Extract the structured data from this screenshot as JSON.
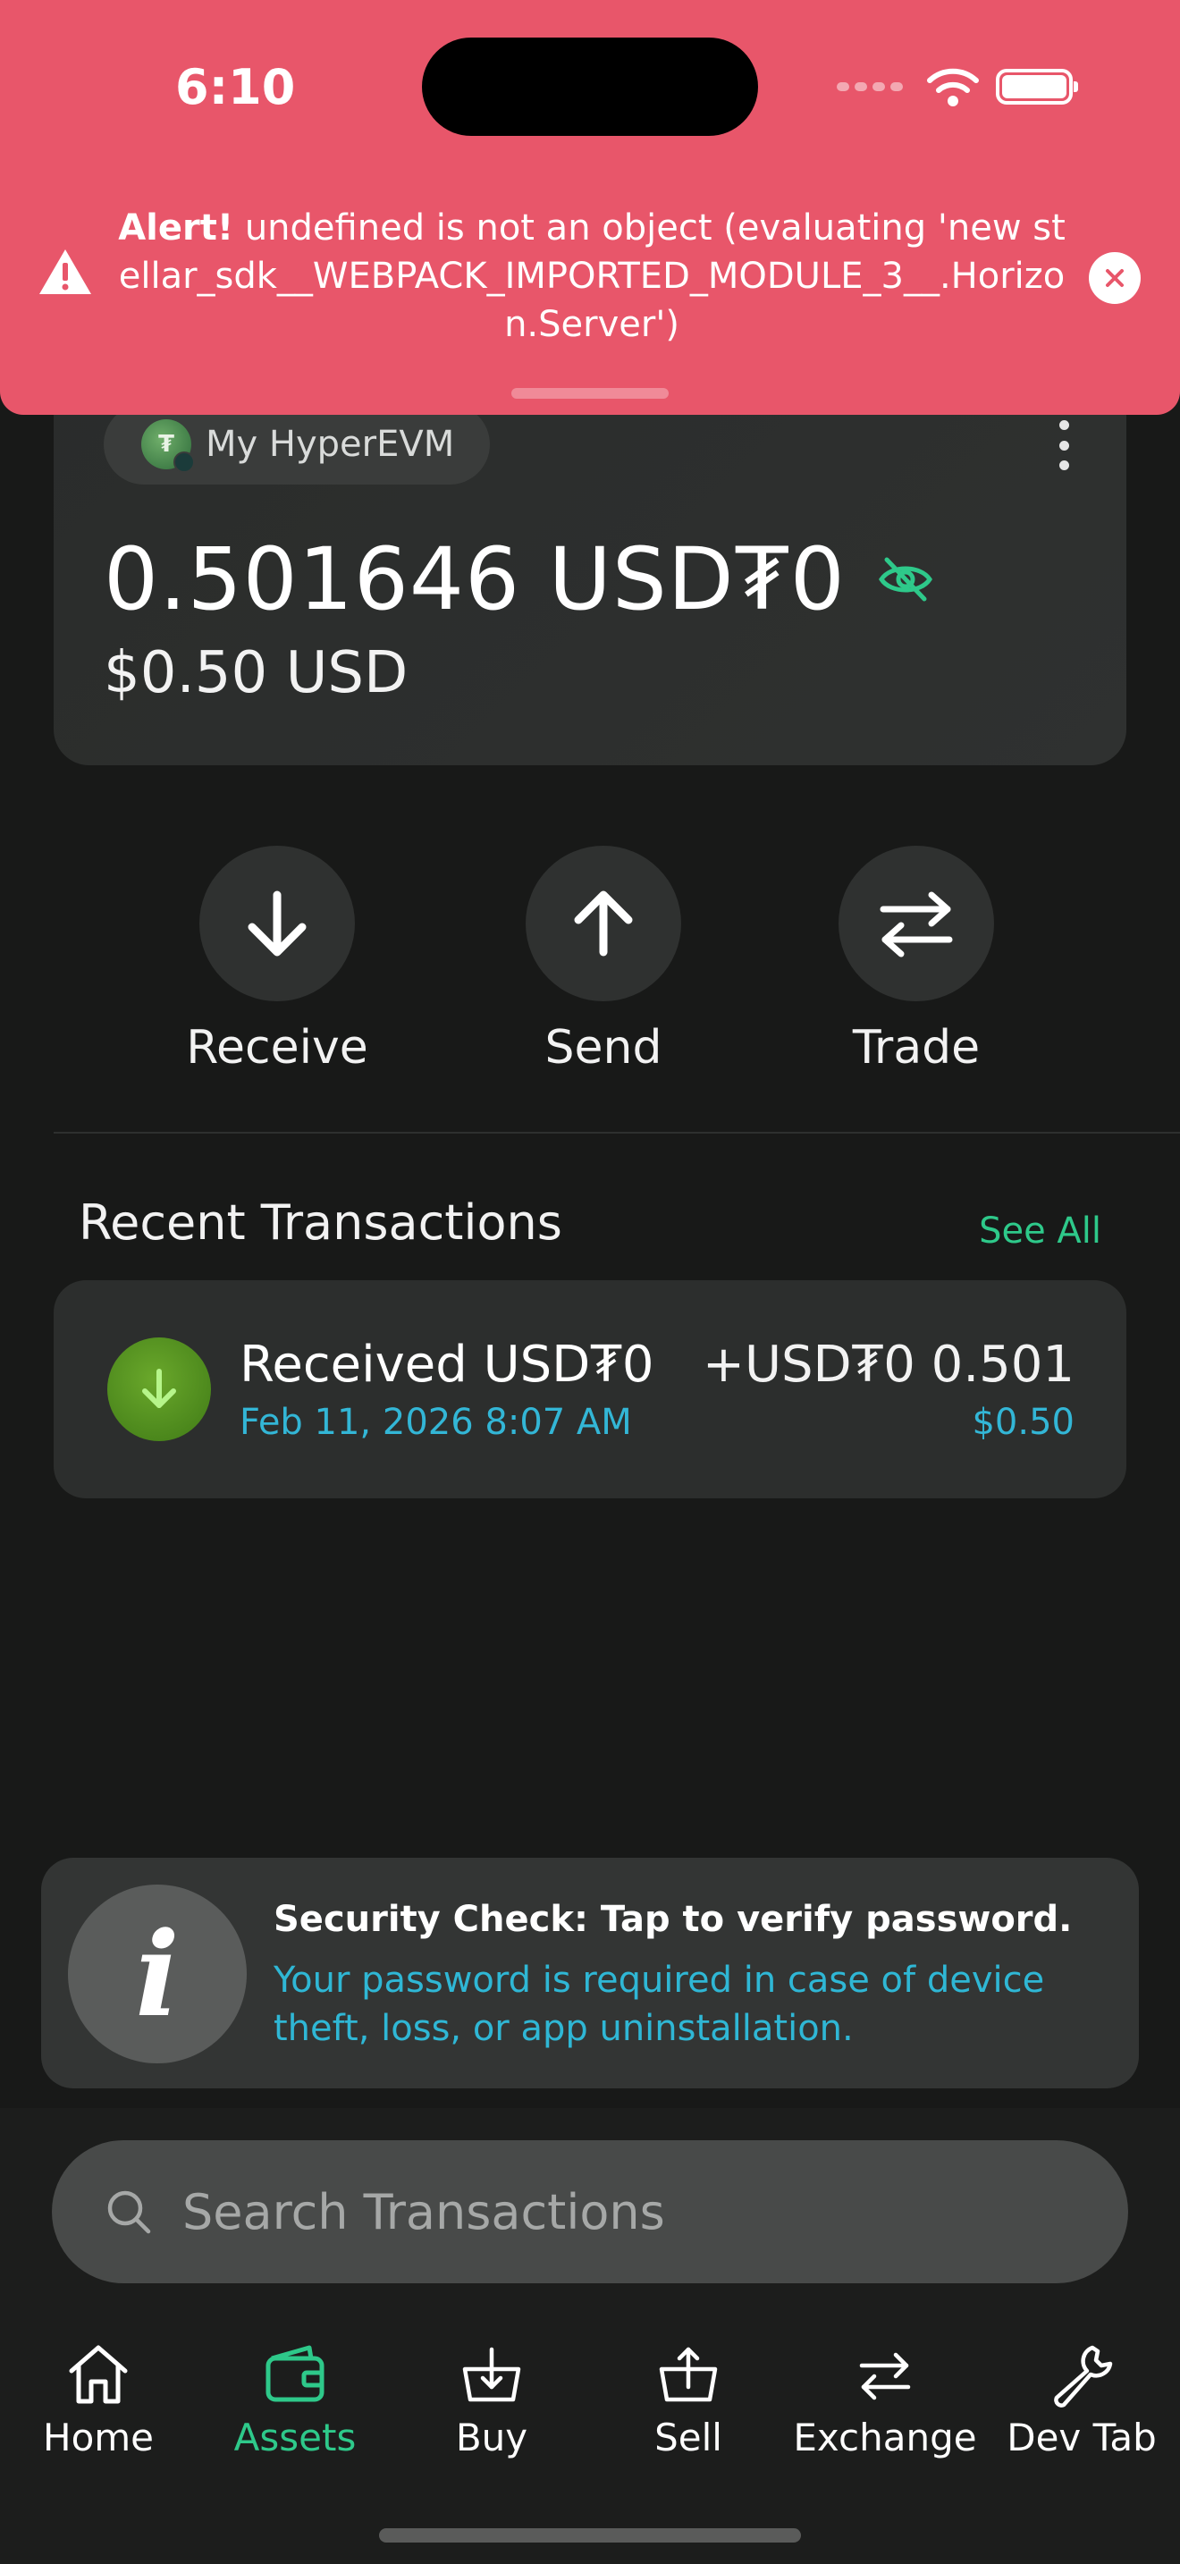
{
  "status_bar": {
    "time": "6:10"
  },
  "alert": {
    "prefix": "Alert!",
    "message": "undefined is not an object (evaluating 'new stellar_sdk__WEBPACK_IMPORTED_MODULE_3__.Horizon.Server')"
  },
  "wallet": {
    "account_name": "My HyperEVM",
    "chip_glyph": "₮",
    "balance": "0.501646 USD₮0",
    "fiat_balance": "$0.50 USD"
  },
  "actions": [
    {
      "label": "Receive",
      "icon": "arrow-down-icon"
    },
    {
      "label": "Send",
      "icon": "arrow-up-icon"
    },
    {
      "label": "Trade",
      "icon": "swap-icon"
    }
  ],
  "transactions": {
    "title": "Recent Transactions",
    "see_all": "See All",
    "items": [
      {
        "title": "Received USD₮0",
        "date": "Feb 11, 2026",
        "time": "8:07 AM",
        "amount": "+USD₮0 0.501",
        "fiat": "$0.50"
      }
    ]
  },
  "security": {
    "title": "Security Check: Tap to verify password.",
    "body": "Your password is required in case of device theft, loss, or app uninstallation."
  },
  "search": {
    "placeholder": "Search Transactions"
  },
  "tabs": [
    {
      "label": "Home",
      "icon": "home-icon",
      "active": false
    },
    {
      "label": "Assets",
      "icon": "wallet-icon",
      "active": true
    },
    {
      "label": "Buy",
      "icon": "buy-basket-icon",
      "active": false
    },
    {
      "label": "Sell",
      "icon": "sell-basket-icon",
      "active": false
    },
    {
      "label": "Exchange",
      "icon": "exchange-icon",
      "active": false
    },
    {
      "label": "Dev Tab",
      "icon": "wrench-icon",
      "active": false
    }
  ],
  "colors": {
    "accent": "#2ec98a",
    "link": "#33b6d6",
    "alert": "#e8566a"
  }
}
